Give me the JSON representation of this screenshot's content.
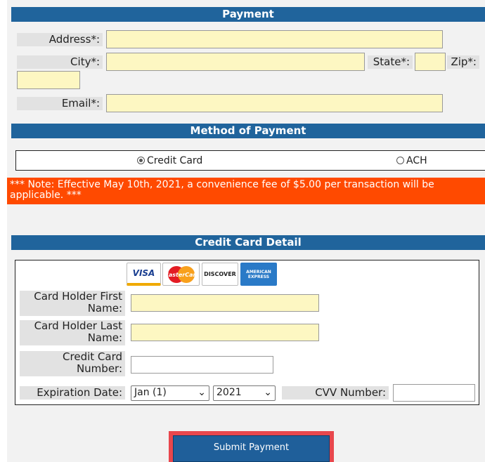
{
  "payment": {
    "header": "Payment",
    "address_label": "Address*:",
    "city_label": "City*:",
    "state_label": "State*:",
    "zip_label": "Zip*:",
    "email_label": "Email*:"
  },
  "method": {
    "header": "Method of Payment",
    "options": [
      {
        "label": "Credit Card",
        "selected": true
      },
      {
        "label": "ACH",
        "selected": false
      }
    ],
    "note": "*** Note: Effective May 10th, 2021, a convenience fee of $5.00 per transaction will be applicable. ***"
  },
  "card_detail": {
    "header": "Credit Card Detail",
    "logos": [
      "VISA",
      "MasterCard",
      "DISCOVER",
      "AMERICAN EXPRESS"
    ],
    "first_name_label": "Card Holder First Name:",
    "last_name_label": "Card Holder Last Name:",
    "card_number_label": "Credit Card Number:",
    "expiration_label": "Expiration Date:",
    "exp_month": "Jan (1)",
    "exp_year": "2021",
    "cvv_label": "CVV Number:"
  },
  "submit_label": "Submit Payment",
  "colors": {
    "header_blue": "#20649c",
    "input_yellow": "#fdf7c2",
    "note_orange": "#ff4a00",
    "highlight_red": "#e8474d"
  }
}
